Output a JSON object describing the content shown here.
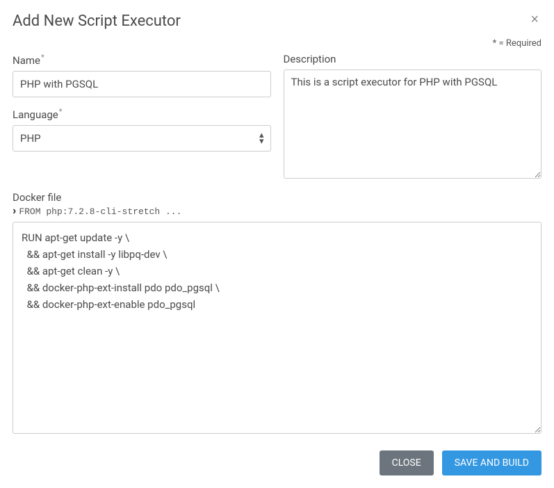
{
  "modal": {
    "title": "Add New Script Executor",
    "required_note": "* = Required"
  },
  "fields": {
    "name": {
      "label": "Name",
      "value": "PHP with PGSQL"
    },
    "description": {
      "label": "Description",
      "value": "This is a script executor for PHP with PGSQL"
    },
    "language": {
      "label": "Language",
      "value": "PHP"
    },
    "dockerfile": {
      "label": "Docker file",
      "preview": "FROM php:7.2.8-cli-stretch ...",
      "value": "RUN apt-get update -y \\\n  && apt-get install -y libpq-dev \\\n  && apt-get clean -y \\\n  && docker-php-ext-install pdo pdo_pgsql \\\n  && docker-php-ext-enable pdo_pgsql"
    }
  },
  "buttons": {
    "close": "CLOSE",
    "save": "SAVE AND BUILD"
  }
}
